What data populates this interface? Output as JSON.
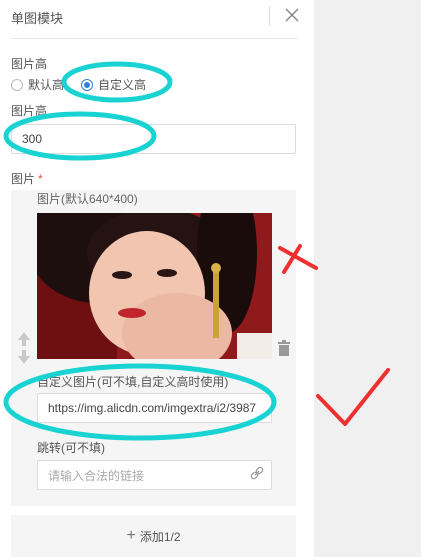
{
  "panel": {
    "title": "单图模块",
    "close_icon": "close-icon"
  },
  "height_section": {
    "label": "图片高",
    "options": [
      {
        "label": "默认高",
        "checked": false
      },
      {
        "label": "自定义高",
        "checked": true
      }
    ]
  },
  "height_input": {
    "label": "图片高",
    "value": "300"
  },
  "image_section": {
    "label": "图片",
    "required_mark": "*",
    "image_label": "图片(默认640*400)",
    "custom_label": "自定义图片(可不填,自定义高时使用)",
    "custom_value": "https://img.alicdn.com/imgextra/i2/3987",
    "jump_label": "跳转(可不填)",
    "jump_placeholder": "请输入合法的链接"
  },
  "add_button": {
    "label": "添加1/2"
  },
  "colors": {
    "accent": "#2f7fe0",
    "annotation_cyan": "#19d3d3",
    "annotation_red": "#ee3030"
  }
}
